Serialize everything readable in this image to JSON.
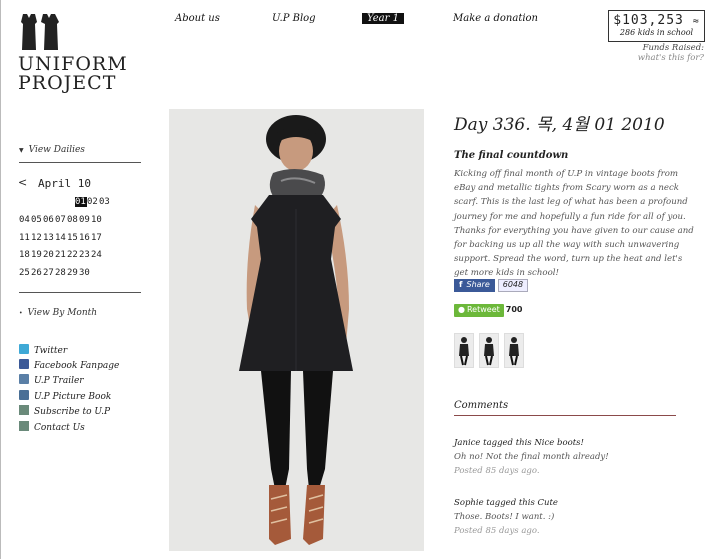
{
  "logo": {
    "line1": "UNIFORM",
    "line2": "PROJECT"
  },
  "nav": [
    {
      "label": "About us"
    },
    {
      "label": "U.P Blog"
    },
    {
      "label": "Year 1"
    },
    {
      "label": "Make a donation"
    }
  ],
  "funds": {
    "amount": "$103,253",
    "kids": "286 kids in school",
    "label": "Funds Raised:",
    "link": "what's this for?"
  },
  "sidebar": {
    "view_dailies": "View Dailies",
    "calendar": {
      "prev": "<",
      "month": "April 10",
      "rows": [
        [
          "01",
          "02",
          "03"
        ],
        [
          "04",
          "05",
          "06",
          "07",
          "08",
          "09",
          "10"
        ],
        [
          "11",
          "12",
          "13",
          "14",
          "15",
          "16",
          "17"
        ],
        [
          "18",
          "19",
          "20",
          "21",
          "22",
          "23",
          "24"
        ],
        [
          "25",
          "26",
          "27",
          "28",
          "29",
          "30"
        ]
      ],
      "selected": "01"
    },
    "view_by_month": "View By Month",
    "links": [
      {
        "label": "Twitter",
        "icon": "twitter-icon",
        "color": "#3fa9d6"
      },
      {
        "label": "Facebook Fanpage",
        "icon": "facebook-icon",
        "color": "#3b5998"
      },
      {
        "label": "U.P Trailer",
        "icon": "video-icon",
        "color": "#5a7fa6"
      },
      {
        "label": "U.P Picture Book",
        "icon": "book-icon",
        "color": "#4a6f96"
      },
      {
        "label": "Subscribe to U.P",
        "icon": "envelope-icon",
        "color": "#6a8a7a"
      },
      {
        "label": "Contact Us",
        "icon": "envelope-icon",
        "color": "#6a8a7a"
      }
    ]
  },
  "post": {
    "title": "Day 336. 목, 4월 01 2010",
    "subtitle": "The final countdown",
    "body": "Kicking off final month of U.P in vintage boots from eBay and metallic tights from Scary worn as a neck scarf. This is the last leg of what has been a profound journey for me and hopefully a fun ride for all of you. Thanks for everything you have given to our cause and for backing us up all the way with such unwavering support. Spread the word, turn up the heat and let's get more kids in school!",
    "share_label": "Share",
    "share_count": "6048",
    "retweet_label": "Retweet",
    "retweet_count": "700"
  },
  "comments": {
    "heading": "Comments",
    "items": [
      {
        "head": "Janice tagged this Nice boots!",
        "body": "Oh no! Not the final month already!",
        "date": "Posted 85 days ago."
      },
      {
        "head": "Sophie tagged this Cute",
        "body": "Those. Boots! I want. :)",
        "date": "Posted 85 days ago."
      }
    ]
  },
  "colors": {
    "accent": "#8b4a4a",
    "facebook": "#3b5998",
    "retweet": "#6cb83a"
  }
}
